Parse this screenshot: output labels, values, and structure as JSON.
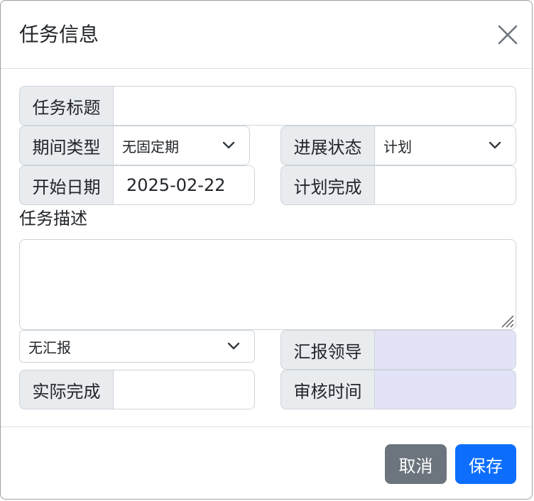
{
  "dialog": {
    "title": "任务信息",
    "close_icon": "close-icon"
  },
  "form": {
    "task_title": {
      "label": "任务标题",
      "value": ""
    },
    "period_type": {
      "label": "期间类型",
      "selected": "无固定期"
    },
    "progress_status": {
      "label": "进展状态",
      "selected": "计划"
    },
    "start_date": {
      "label": "开始日期",
      "value": "2025-02-22"
    },
    "planned_completion": {
      "label": "计划完成",
      "value": ""
    },
    "task_description": {
      "label": "任务描述",
      "value": ""
    },
    "report_select": {
      "selected": "无汇报"
    },
    "report_leader": {
      "label": "汇报领导",
      "value": ""
    },
    "actual_completion": {
      "label": "实际完成",
      "value": ""
    },
    "review_time": {
      "label": "审核时间",
      "value": ""
    }
  },
  "footer": {
    "cancel_label": "取消",
    "save_label": "保存"
  },
  "colors": {
    "primary": "#0d6efd",
    "secondary": "#6c757d",
    "readonly_bg": "#e3e3f8",
    "label_bg": "#e9ecef"
  }
}
